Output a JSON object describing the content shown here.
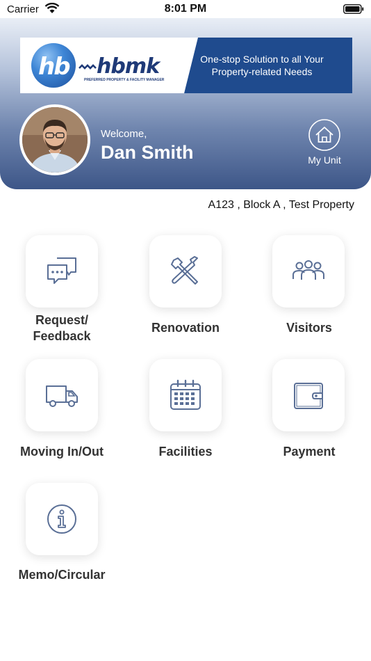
{
  "status_bar": {
    "carrier": "Carrier",
    "time": "8:01 PM"
  },
  "banner": {
    "logo_left": "hb",
    "logo_right": "hbmk",
    "logo_subtitle": "PREFERRED PROPERTY & FACILITY MANAGER",
    "tagline": "One-stop Solution to all Your Property-related Needs"
  },
  "user": {
    "welcome": "Welcome,",
    "name": "Dan Smith"
  },
  "my_unit": {
    "label": "My Unit"
  },
  "address": "A123 , Block A , Test Property",
  "menu": [
    {
      "label": "Request/ Feedback",
      "icon": "chat-bubbles-icon"
    },
    {
      "label": "Renovation",
      "icon": "tools-icon"
    },
    {
      "label": "Visitors",
      "icon": "people-group-icon"
    },
    {
      "label": "Moving In/Out",
      "icon": "truck-icon"
    },
    {
      "label": "Facilities",
      "icon": "calendar-icon"
    },
    {
      "label": "Payment",
      "icon": "wallet-icon"
    },
    {
      "label": "Memo/Circular",
      "icon": "info-icon"
    }
  ],
  "colors": {
    "header_top": "#e9eef6",
    "header_bottom": "#3d5688",
    "icon_stroke": "#5a6f96",
    "banner_blue": "#1f4b8e"
  }
}
